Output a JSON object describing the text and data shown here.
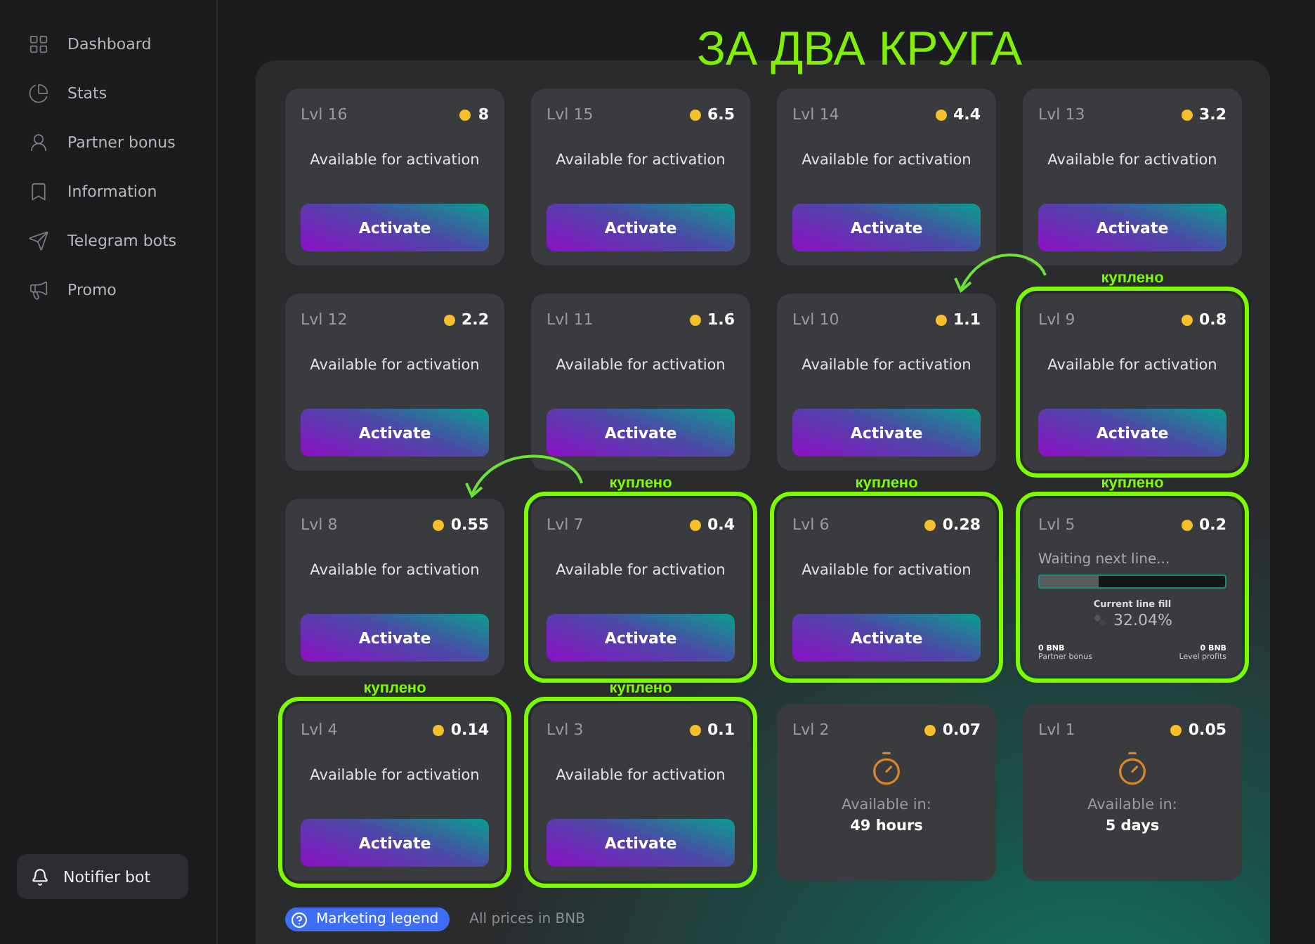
{
  "annotation_title": "ЗА ДВА КРУГА",
  "sidebar": {
    "items": [
      {
        "label": "Dashboard"
      },
      {
        "label": "Stats"
      },
      {
        "label": "Partner bonus"
      },
      {
        "label": "Information"
      },
      {
        "label": "Telegram bots"
      },
      {
        "label": "Promo"
      }
    ],
    "notifier_button": "Notifier bot"
  },
  "levels": [
    {
      "kind": "activate",
      "level_label": "Lvl 16",
      "price": "8",
      "status": "Available for activation",
      "button": "Activate",
      "highlighted": false
    },
    {
      "kind": "activate",
      "level_label": "Lvl 15",
      "price": "6.5",
      "status": "Available for activation",
      "button": "Activate",
      "highlighted": false
    },
    {
      "kind": "activate",
      "level_label": "Lvl 14",
      "price": "4.4",
      "status": "Available for activation",
      "button": "Activate",
      "highlighted": false
    },
    {
      "kind": "activate",
      "level_label": "Lvl 13",
      "price": "3.2",
      "status": "Available for activation",
      "button": "Activate",
      "highlighted": false
    },
    {
      "kind": "activate",
      "level_label": "Lvl 12",
      "price": "2.2",
      "status": "Available for activation",
      "button": "Activate",
      "highlighted": false
    },
    {
      "kind": "activate",
      "level_label": "Lvl 11",
      "price": "1.6",
      "status": "Available for activation",
      "button": "Activate",
      "highlighted": false
    },
    {
      "kind": "activate",
      "level_label": "Lvl 10",
      "price": "1.1",
      "status": "Available for activation",
      "button": "Activate",
      "highlighted": false
    },
    {
      "kind": "activate",
      "level_label": "Lvl 9",
      "price": "0.8",
      "status": "Available for activation",
      "button": "Activate",
      "highlighted": true,
      "note": "куплено"
    },
    {
      "kind": "activate",
      "level_label": "Lvl 8",
      "price": "0.55",
      "status": "Available for activation",
      "button": "Activate",
      "highlighted": false
    },
    {
      "kind": "activate",
      "level_label": "Lvl 7",
      "price": "0.4",
      "status": "Available for activation",
      "button": "Activate",
      "highlighted": true,
      "note": "куплено"
    },
    {
      "kind": "activate",
      "level_label": "Lvl 6",
      "price": "0.28",
      "status": "Available for activation",
      "button": "Activate",
      "highlighted": true,
      "note": "куплено"
    },
    {
      "kind": "waiting",
      "level_label": "Lvl 5",
      "price": "0.2",
      "status": "Waiting next line...",
      "level": 0.32,
      "fill_label": "Current line fill",
      "fill_value": "32.04%",
      "partner_bonus": "0 BNB",
      "partner_bonus_label": "Partner bonus",
      "level_profits": "0 BNB",
      "level_profits_label": "Level profits",
      "highlighted": true,
      "note": "куплено"
    },
    {
      "kind": "activate",
      "level_label": "Lvl 4",
      "price": "0.14",
      "status": "Available for activation",
      "button": "Activate",
      "highlighted": true,
      "note": "куплено"
    },
    {
      "kind": "activate",
      "level_label": "Lvl 3",
      "price": "0.1",
      "status": "Available for activation",
      "button": "Activate",
      "highlighted": true,
      "note": "куплено"
    },
    {
      "kind": "timer",
      "level_label": "Lvl 2",
      "price": "0.07",
      "status": "Available in:",
      "time": "49 hours",
      "highlighted": false
    },
    {
      "kind": "timer",
      "level_label": "Lvl 1",
      "price": "0.05",
      "status": "Available in:",
      "time": "5 days",
      "highlighted": false
    }
  ],
  "footer": {
    "legend_button": "Marketing legend",
    "note": "All prices in BNB"
  }
}
